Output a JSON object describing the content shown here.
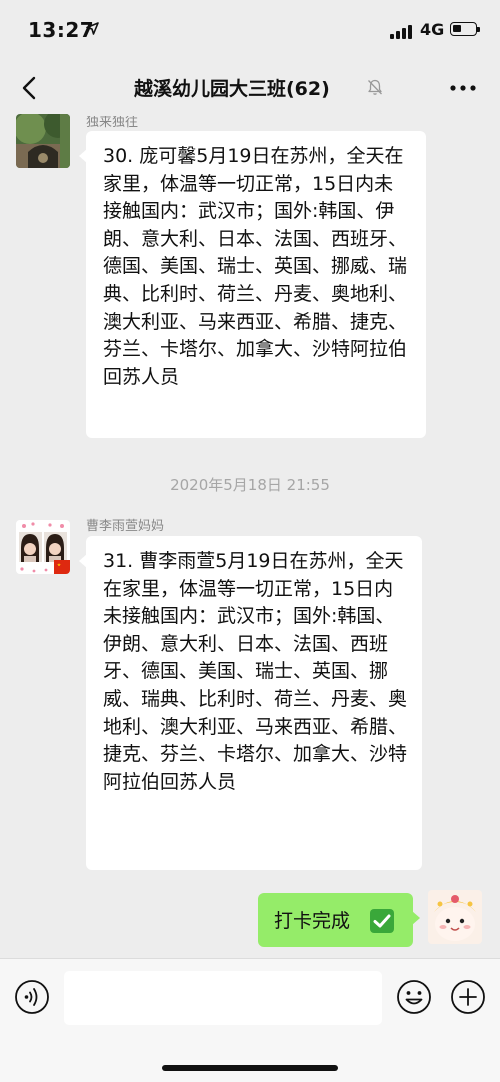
{
  "status_bar": {
    "time": "13:27",
    "network": "4G"
  },
  "header": {
    "title": "越溪幼儿园大三班(62)"
  },
  "messages": [
    {
      "sender": "独来独往",
      "text": "30. 庞可馨5月19日在苏州，全天在家里，体温等一切正常，15日内未接触国内：武汉市；国外:韩国、伊朗、意大利、日本、法国、西班牙、德国、美国、瑞士、英国、挪威、瑞典、比利时、荷兰、丹麦、奥地利、澳大利亚、马来西亚、希腊、捷克、芬兰、卡塔尔、加拿大、沙特阿拉伯回苏人员"
    },
    {
      "sender": "曹李雨萱妈妈",
      "text": "31. 曹李雨萱5月19日在苏州，全天在家里，体温等一切正常，15日内未接触国内：武汉市；国外:韩国、伊朗、意大利、日本、法国、西班牙、德国、美国、瑞士、英国、挪威、瑞典、比利时、荷兰、丹麦、奥地利、澳大利亚、马来西亚、希腊、捷克、芬兰、卡塔尔、加拿大、沙特阿拉伯回苏人员"
    },
    {
      "sender": "",
      "text": "打卡完成"
    }
  ],
  "timestamp": "2020年5月18日 21:55",
  "icons": {
    "back": "chevron-left-icon",
    "mute": "bell-slash-icon",
    "more": "more-dots-icon",
    "voice": "voice-icon",
    "emoji": "emoji-icon",
    "plus": "plus-icon",
    "check": "check-mark-emoji"
  },
  "colors": {
    "background": "#ededed",
    "bubble_in": "#ffffff",
    "bubble_out": "#95ec69",
    "name_text": "#888888",
    "timestamp_text": "#a6a6a6"
  }
}
